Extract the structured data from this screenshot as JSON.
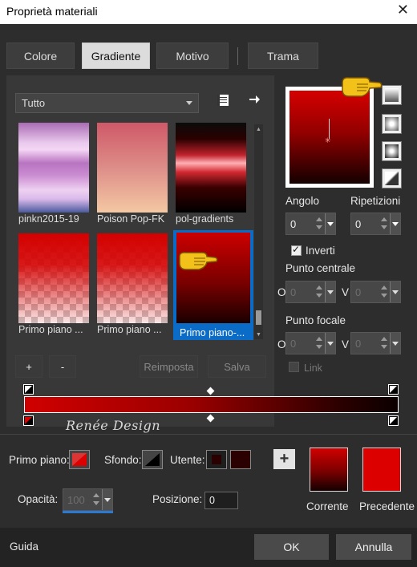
{
  "window": {
    "title": "Proprietà materiali",
    "close_glyph": "✕"
  },
  "tabs": [
    {
      "label": "Colore",
      "active": false
    },
    {
      "label": "Gradiente",
      "active": true
    },
    {
      "label": "Motivo",
      "active": false
    },
    {
      "label": "Trama",
      "active": false
    }
  ],
  "library": {
    "category": "Tutto",
    "gradients": [
      {
        "name": "pinkn2015-19",
        "selected": false
      },
      {
        "name": "Poison Pop-FK",
        "selected": false
      },
      {
        "name": "pol-gradients",
        "selected": false
      },
      {
        "name": "Primo piano ...",
        "selected": false
      },
      {
        "name": "Primo piano ...",
        "selected": false
      },
      {
        "name": "Primo piano-...",
        "selected": true
      }
    ],
    "add_label": "+",
    "remove_label": "-",
    "reset_label": "Reimposta",
    "save_label": "Salva"
  },
  "settings": {
    "angle_label": "Angolo",
    "angle_value": "0",
    "repeats_label": "Ripetizioni",
    "repeats_value": "0",
    "invert_label": "Inverti",
    "invert_checked": true,
    "center_label": "Punto centrale",
    "center_h_label": "O",
    "center_h_value": "0",
    "center_v_label": "V",
    "center_v_value": "0",
    "focus_label": "Punto focale",
    "focus_h_label": "O",
    "focus_h_value": "0",
    "focus_v_label": "V",
    "focus_v_value": "0",
    "link_label": "Link",
    "link_checked": false
  },
  "bottom": {
    "foreground_label": "Primo piano:",
    "background_label": "Sfondo:",
    "user_label": "Utente:",
    "opacity_label": "Opacità:",
    "opacity_value": "100",
    "position_label": "Posizione:",
    "position_value": "0",
    "current_label": "Corrente",
    "previous_label": "Precedente",
    "add_glyph": "+",
    "user_color": "#2a0000",
    "current_color": "#d00000",
    "previous_color": "#dd0000"
  },
  "watermark": "Renée Design",
  "footer": {
    "help_label": "Guida",
    "ok_label": "OK",
    "cancel_label": "Annulla"
  }
}
